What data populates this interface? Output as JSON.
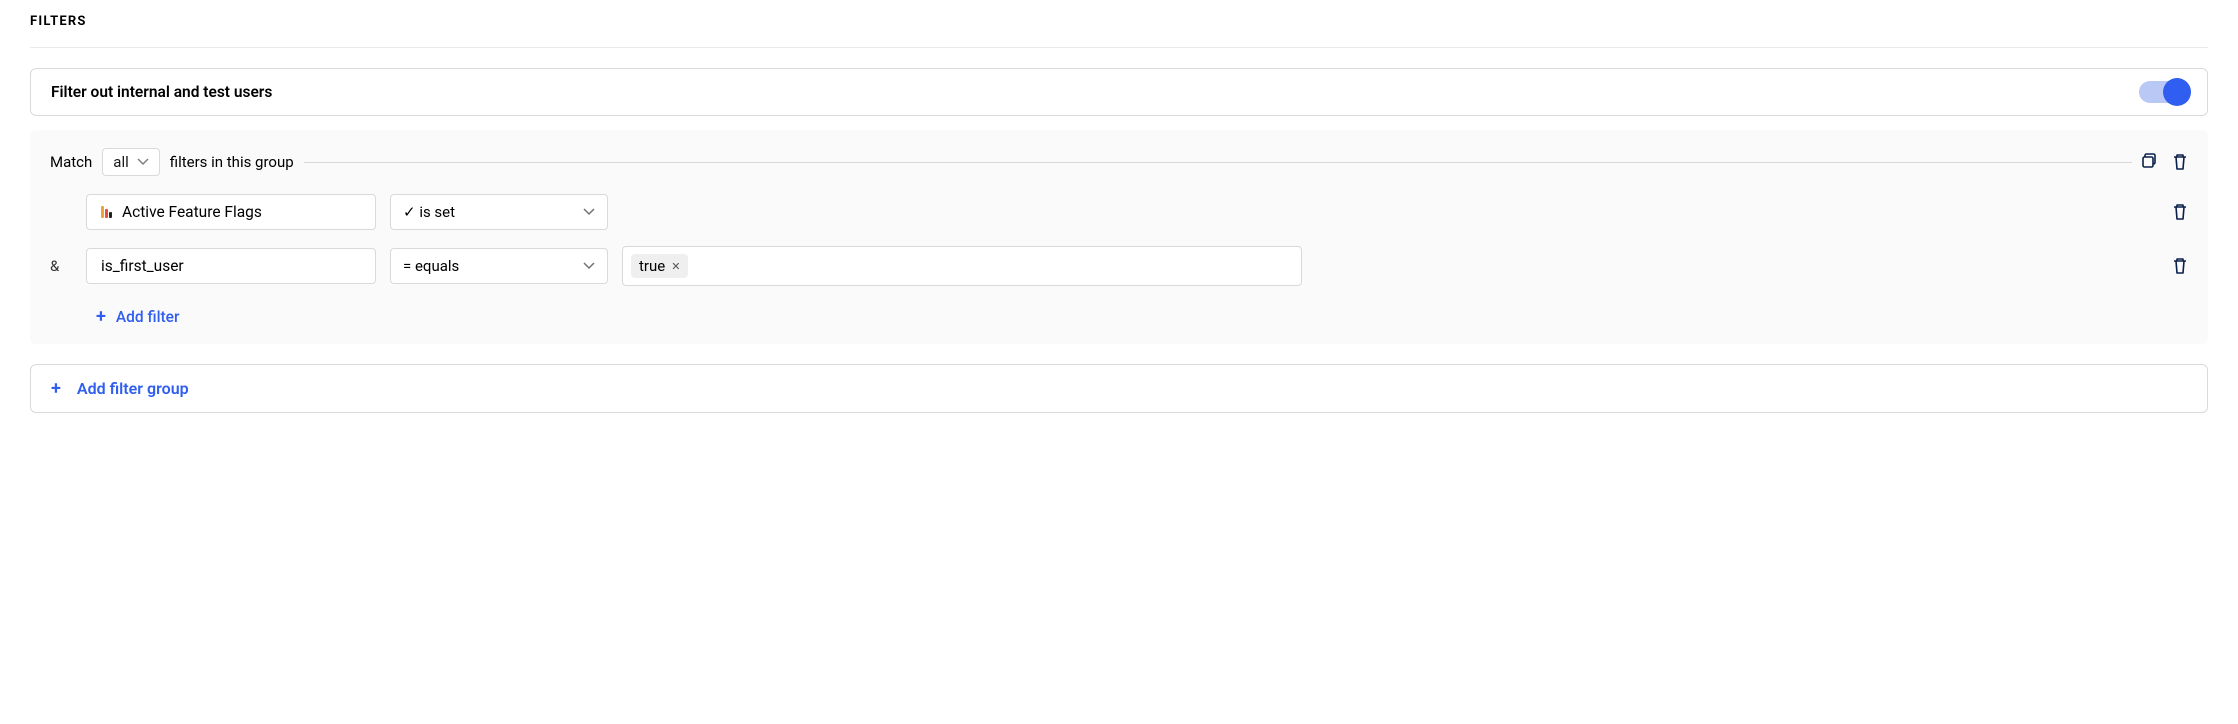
{
  "section_title": "FILTERS",
  "internal_filter": {
    "label": "Filter out internal and test users",
    "enabled": true
  },
  "group": {
    "match_prefix": "Match",
    "match_mode": "all",
    "match_suffix": "filters in this group",
    "rows": [
      {
        "connector": "",
        "property": "Active Feature Flags",
        "property_icon": "flag",
        "operator_symbol": "✓",
        "operator_label": "is set",
        "values": []
      },
      {
        "connector": "&",
        "property": "is_first_user",
        "property_icon": "",
        "operator_symbol": "=",
        "operator_label": "equals",
        "values": [
          "true"
        ]
      }
    ],
    "add_filter_label": "Add filter"
  },
  "add_group_label": "Add filter group"
}
